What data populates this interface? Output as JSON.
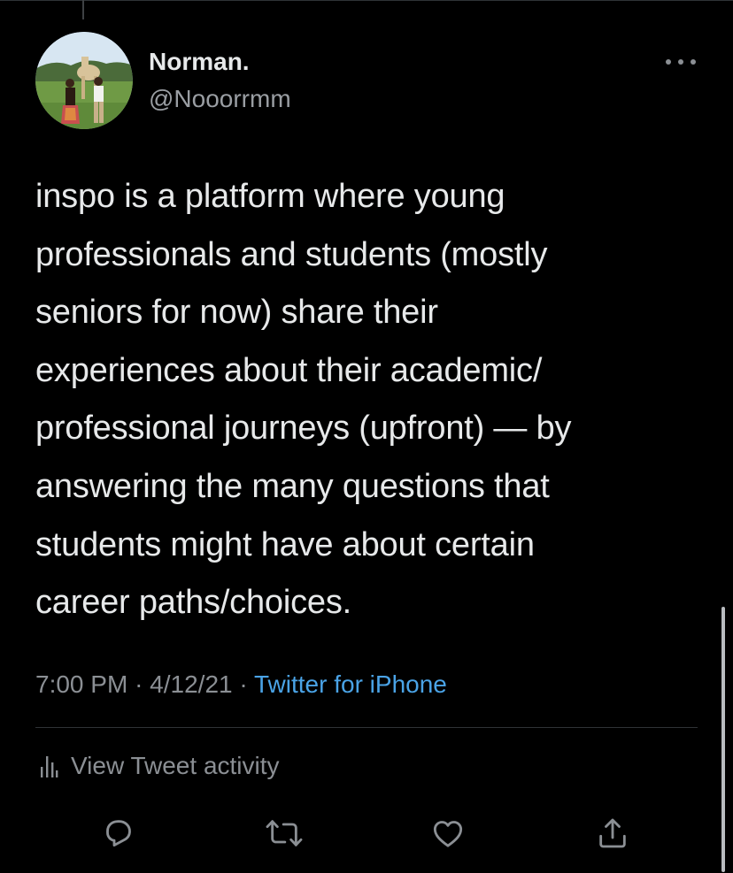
{
  "tweet": {
    "display_name": "Norman.",
    "handle": "@Nooorrmm",
    "text": "inspo is a platform where young\nprofessionals and students (mostly\nseniors for now) share their\nexperiences about their academic/\nprofessional journeys (upfront) — by\nanswering the many questions that\nstudents might have about certain\ncareer paths/choices.",
    "time": "7:00 PM",
    "date": "4/12/21",
    "separator": "·",
    "source": "Twitter for iPhone",
    "activity_label": "View Tweet activity"
  },
  "icons": {
    "more": "more-icon",
    "activity": "bar-chart-icon",
    "reply": "reply-icon",
    "retweet": "retweet-icon",
    "like": "heart-icon",
    "share": "share-icon"
  },
  "colors": {
    "background": "#000000",
    "text": "#e7e9ea",
    "muted": "#8b8f94",
    "link": "#4aa3e6",
    "divider": "#2f3336"
  }
}
